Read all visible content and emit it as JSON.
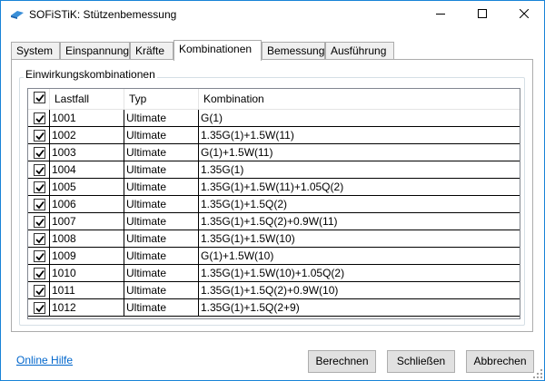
{
  "window": {
    "title": "SOFiSTiK: Stützenbemessung",
    "icon": "sofistik-logo-icon",
    "accent_color": "#1883d7"
  },
  "tabs": [
    {
      "label": "System",
      "active": false
    },
    {
      "label": "Einspannung",
      "active": false
    },
    {
      "label": "Kräfte",
      "active": false
    },
    {
      "label": "Kombinationen",
      "active": true
    },
    {
      "label": "Bemessung",
      "active": false
    },
    {
      "label": "Ausführung",
      "active": false
    }
  ],
  "group": {
    "title": "Einwirkungskombinationen"
  },
  "table": {
    "header_checked": true,
    "columns": [
      "Lastfall",
      "Typ",
      "Kombination"
    ],
    "rows": [
      {
        "checked": true,
        "lastfall": "1001",
        "typ": "Ultimate",
        "kombination": "G(1)"
      },
      {
        "checked": true,
        "lastfall": "1002",
        "typ": "Ultimate",
        "kombination": "1.35G(1)+1.5W(11)"
      },
      {
        "checked": true,
        "lastfall": "1003",
        "typ": "Ultimate",
        "kombination": "G(1)+1.5W(11)"
      },
      {
        "checked": true,
        "lastfall": "1004",
        "typ": "Ultimate",
        "kombination": "1.35G(1)"
      },
      {
        "checked": true,
        "lastfall": "1005",
        "typ": "Ultimate",
        "kombination": "1.35G(1)+1.5W(11)+1.05Q(2)"
      },
      {
        "checked": true,
        "lastfall": "1006",
        "typ": "Ultimate",
        "kombination": "1.35G(1)+1.5Q(2)"
      },
      {
        "checked": true,
        "lastfall": "1007",
        "typ": "Ultimate",
        "kombination": "1.35G(1)+1.5Q(2)+0.9W(11)"
      },
      {
        "checked": true,
        "lastfall": "1008",
        "typ": "Ultimate",
        "kombination": "1.35G(1)+1.5W(10)"
      },
      {
        "checked": true,
        "lastfall": "1009",
        "typ": "Ultimate",
        "kombination": "G(1)+1.5W(10)"
      },
      {
        "checked": true,
        "lastfall": "1010",
        "typ": "Ultimate",
        "kombination": "1.35G(1)+1.5W(10)+1.05Q(2)"
      },
      {
        "checked": true,
        "lastfall": "1011",
        "typ": "Ultimate",
        "kombination": "1.35G(1)+1.5Q(2)+0.9W(10)"
      },
      {
        "checked": true,
        "lastfall": "1012",
        "typ": "Ultimate",
        "kombination": "1.35G(1)+1.5Q(2+9)"
      }
    ]
  },
  "footer": {
    "help_link": "Online Hilfe",
    "buttons": {
      "calculate": "Berechnen",
      "close": "Schließen",
      "cancel": "Abbrechen"
    }
  }
}
